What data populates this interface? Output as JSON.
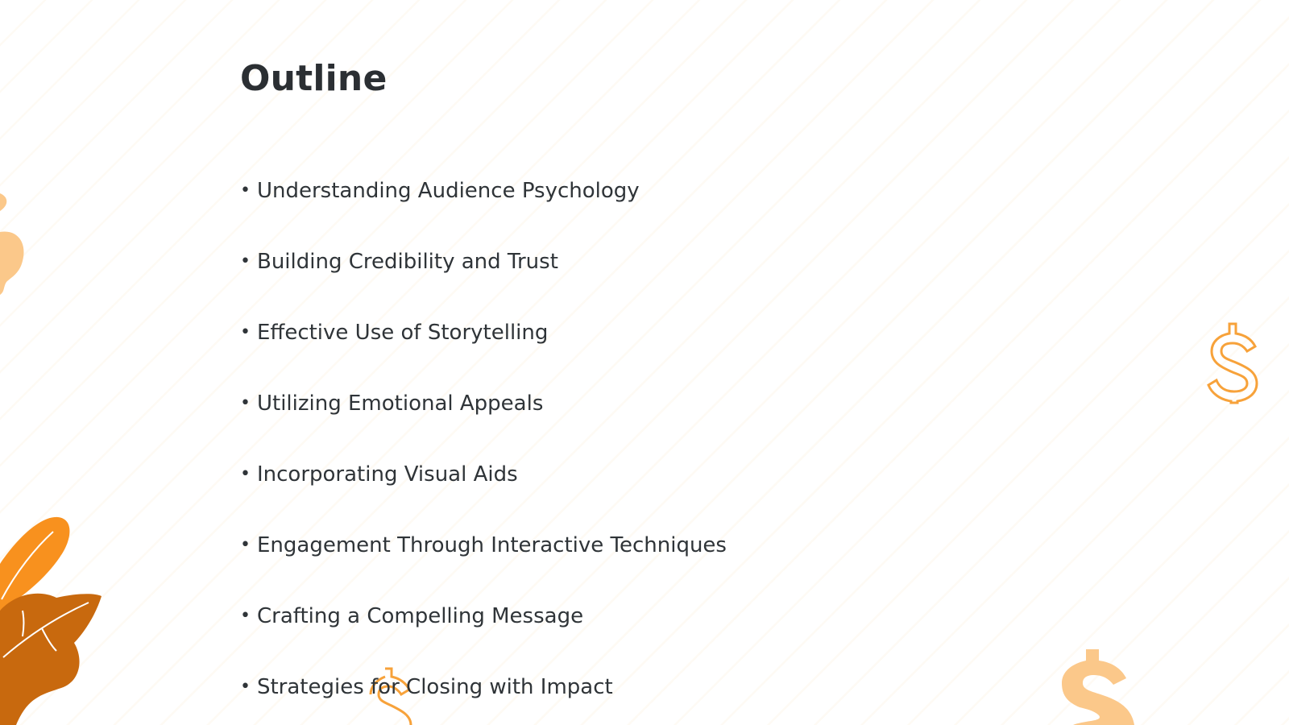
{
  "slide": {
    "title": "Outline",
    "bullet_marker": "•",
    "items": [
      "Understanding Audience Psychology",
      "Building Credibility and Trust",
      "Effective Use of Storytelling",
      "Utilizing Emotional Appeals",
      "Incorporating Visual Aids",
      "Engagement Through Interactive Techniques",
      "Crafting a Compelling Message",
      "Strategies for Closing with Impact"
    ]
  },
  "decorations": {
    "icons": [
      "dollar-outline-icon",
      "dollar-solid-icon",
      "leaf-icon",
      "blob-icon"
    ],
    "colors": {
      "orange": "#f7a23a",
      "orange_light": "#fbc88a",
      "orange_dark": "#c8690e",
      "leaf_bright": "#f8911e"
    }
  }
}
